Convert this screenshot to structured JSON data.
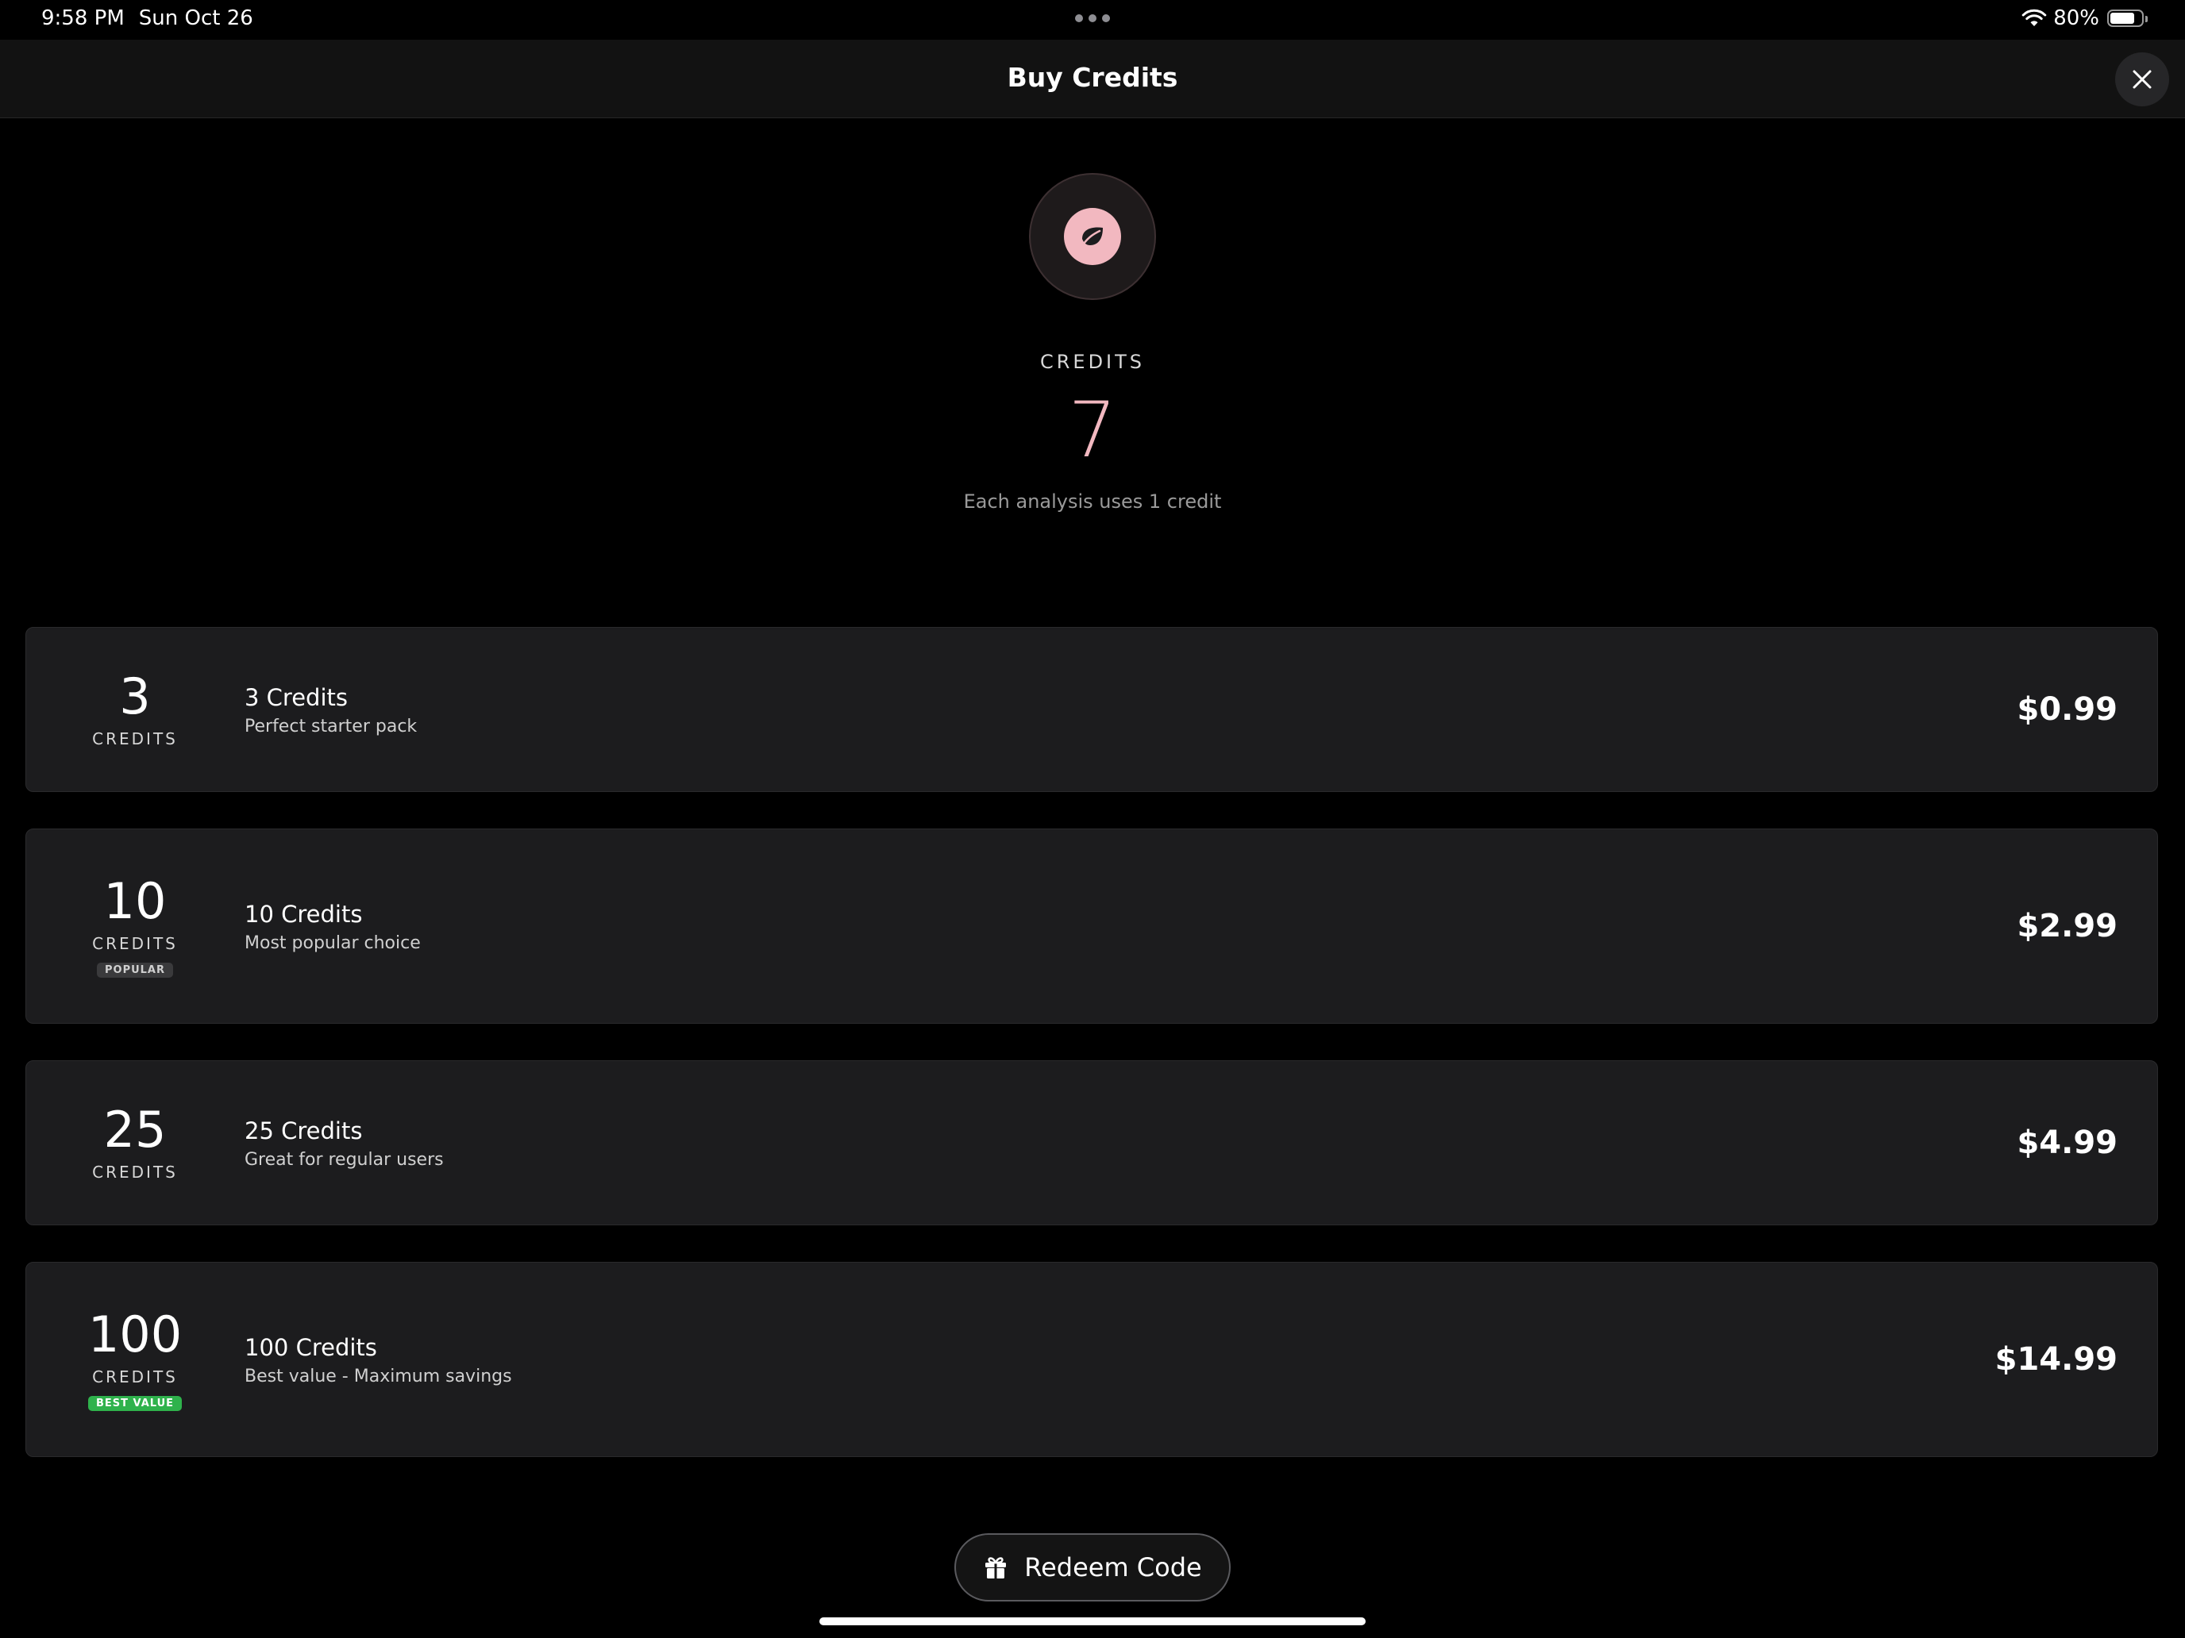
{
  "status_bar": {
    "time": "9:58 PM",
    "date": "Sun Oct 26",
    "battery_percent": "80%",
    "battery_level": 0.8
  },
  "nav": {
    "title": "Buy Credits",
    "close_icon": "close-icon"
  },
  "header": {
    "logo_icon": "leaf-icon",
    "credits_label": "CREDITS",
    "credits_count": "7",
    "note": "Each analysis uses 1 credit"
  },
  "packages": [
    {
      "amount": "3",
      "unit": "CREDITS",
      "name": "3 Credits",
      "description": "Perfect starter pack",
      "price": "$0.99",
      "badge": ""
    },
    {
      "amount": "10",
      "unit": "CREDITS",
      "name": "10 Credits",
      "description": "Most popular choice",
      "price": "$2.99",
      "badge": "POPULAR"
    },
    {
      "amount": "25",
      "unit": "CREDITS",
      "name": "25 Credits",
      "description": "Great for regular users",
      "price": "$4.99",
      "badge": ""
    },
    {
      "amount": "100",
      "unit": "CREDITS",
      "name": "100 Credits",
      "description": "Best value - Maximum savings",
      "price": "$14.99",
      "badge": "BEST VALUE"
    }
  ],
  "redeem": {
    "icon": "gift-icon",
    "label": "Redeem Code"
  },
  "colors": {
    "accent_pink": "#f2b8c0",
    "card_bg": "#1c1c1e",
    "best_value_green": "#2fb24c",
    "background": "#000000"
  }
}
